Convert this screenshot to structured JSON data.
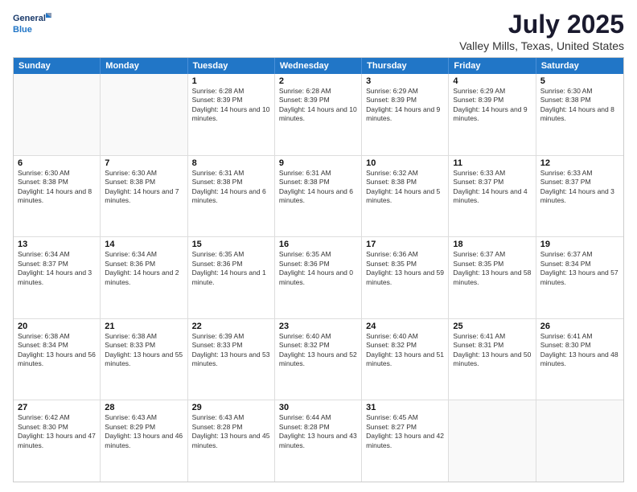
{
  "logo": {
    "line1": "General",
    "line2": "Blue"
  },
  "title": "July 2025",
  "subtitle": "Valley Mills, Texas, United States",
  "days_of_week": [
    "Sunday",
    "Monday",
    "Tuesday",
    "Wednesday",
    "Thursday",
    "Friday",
    "Saturday"
  ],
  "weeks": [
    [
      {
        "day": "",
        "sunrise": "",
        "sunset": "",
        "daylight": ""
      },
      {
        "day": "",
        "sunrise": "",
        "sunset": "",
        "daylight": ""
      },
      {
        "day": "1",
        "sunrise": "Sunrise: 6:28 AM",
        "sunset": "Sunset: 8:39 PM",
        "daylight": "Daylight: 14 hours and 10 minutes."
      },
      {
        "day": "2",
        "sunrise": "Sunrise: 6:28 AM",
        "sunset": "Sunset: 8:39 PM",
        "daylight": "Daylight: 14 hours and 10 minutes."
      },
      {
        "day": "3",
        "sunrise": "Sunrise: 6:29 AM",
        "sunset": "Sunset: 8:39 PM",
        "daylight": "Daylight: 14 hours and 9 minutes."
      },
      {
        "day": "4",
        "sunrise": "Sunrise: 6:29 AM",
        "sunset": "Sunset: 8:39 PM",
        "daylight": "Daylight: 14 hours and 9 minutes."
      },
      {
        "day": "5",
        "sunrise": "Sunrise: 6:30 AM",
        "sunset": "Sunset: 8:38 PM",
        "daylight": "Daylight: 14 hours and 8 minutes."
      }
    ],
    [
      {
        "day": "6",
        "sunrise": "Sunrise: 6:30 AM",
        "sunset": "Sunset: 8:38 PM",
        "daylight": "Daylight: 14 hours and 8 minutes."
      },
      {
        "day": "7",
        "sunrise": "Sunrise: 6:30 AM",
        "sunset": "Sunset: 8:38 PM",
        "daylight": "Daylight: 14 hours and 7 minutes."
      },
      {
        "day": "8",
        "sunrise": "Sunrise: 6:31 AM",
        "sunset": "Sunset: 8:38 PM",
        "daylight": "Daylight: 14 hours and 6 minutes."
      },
      {
        "day": "9",
        "sunrise": "Sunrise: 6:31 AM",
        "sunset": "Sunset: 8:38 PM",
        "daylight": "Daylight: 14 hours and 6 minutes."
      },
      {
        "day": "10",
        "sunrise": "Sunrise: 6:32 AM",
        "sunset": "Sunset: 8:38 PM",
        "daylight": "Daylight: 14 hours and 5 minutes."
      },
      {
        "day": "11",
        "sunrise": "Sunrise: 6:33 AM",
        "sunset": "Sunset: 8:37 PM",
        "daylight": "Daylight: 14 hours and 4 minutes."
      },
      {
        "day": "12",
        "sunrise": "Sunrise: 6:33 AM",
        "sunset": "Sunset: 8:37 PM",
        "daylight": "Daylight: 14 hours and 3 minutes."
      }
    ],
    [
      {
        "day": "13",
        "sunrise": "Sunrise: 6:34 AM",
        "sunset": "Sunset: 8:37 PM",
        "daylight": "Daylight: 14 hours and 3 minutes."
      },
      {
        "day": "14",
        "sunrise": "Sunrise: 6:34 AM",
        "sunset": "Sunset: 8:36 PM",
        "daylight": "Daylight: 14 hours and 2 minutes."
      },
      {
        "day": "15",
        "sunrise": "Sunrise: 6:35 AM",
        "sunset": "Sunset: 8:36 PM",
        "daylight": "Daylight: 14 hours and 1 minute."
      },
      {
        "day": "16",
        "sunrise": "Sunrise: 6:35 AM",
        "sunset": "Sunset: 8:36 PM",
        "daylight": "Daylight: 14 hours and 0 minutes."
      },
      {
        "day": "17",
        "sunrise": "Sunrise: 6:36 AM",
        "sunset": "Sunset: 8:35 PM",
        "daylight": "Daylight: 13 hours and 59 minutes."
      },
      {
        "day": "18",
        "sunrise": "Sunrise: 6:37 AM",
        "sunset": "Sunset: 8:35 PM",
        "daylight": "Daylight: 13 hours and 58 minutes."
      },
      {
        "day": "19",
        "sunrise": "Sunrise: 6:37 AM",
        "sunset": "Sunset: 8:34 PM",
        "daylight": "Daylight: 13 hours and 57 minutes."
      }
    ],
    [
      {
        "day": "20",
        "sunrise": "Sunrise: 6:38 AM",
        "sunset": "Sunset: 8:34 PM",
        "daylight": "Daylight: 13 hours and 56 minutes."
      },
      {
        "day": "21",
        "sunrise": "Sunrise: 6:38 AM",
        "sunset": "Sunset: 8:33 PM",
        "daylight": "Daylight: 13 hours and 55 minutes."
      },
      {
        "day": "22",
        "sunrise": "Sunrise: 6:39 AM",
        "sunset": "Sunset: 8:33 PM",
        "daylight": "Daylight: 13 hours and 53 minutes."
      },
      {
        "day": "23",
        "sunrise": "Sunrise: 6:40 AM",
        "sunset": "Sunset: 8:32 PM",
        "daylight": "Daylight: 13 hours and 52 minutes."
      },
      {
        "day": "24",
        "sunrise": "Sunrise: 6:40 AM",
        "sunset": "Sunset: 8:32 PM",
        "daylight": "Daylight: 13 hours and 51 minutes."
      },
      {
        "day": "25",
        "sunrise": "Sunrise: 6:41 AM",
        "sunset": "Sunset: 8:31 PM",
        "daylight": "Daylight: 13 hours and 50 minutes."
      },
      {
        "day": "26",
        "sunrise": "Sunrise: 6:41 AM",
        "sunset": "Sunset: 8:30 PM",
        "daylight": "Daylight: 13 hours and 48 minutes."
      }
    ],
    [
      {
        "day": "27",
        "sunrise": "Sunrise: 6:42 AM",
        "sunset": "Sunset: 8:30 PM",
        "daylight": "Daylight: 13 hours and 47 minutes."
      },
      {
        "day": "28",
        "sunrise": "Sunrise: 6:43 AM",
        "sunset": "Sunset: 8:29 PM",
        "daylight": "Daylight: 13 hours and 46 minutes."
      },
      {
        "day": "29",
        "sunrise": "Sunrise: 6:43 AM",
        "sunset": "Sunset: 8:28 PM",
        "daylight": "Daylight: 13 hours and 45 minutes."
      },
      {
        "day": "30",
        "sunrise": "Sunrise: 6:44 AM",
        "sunset": "Sunset: 8:28 PM",
        "daylight": "Daylight: 13 hours and 43 minutes."
      },
      {
        "day": "31",
        "sunrise": "Sunrise: 6:45 AM",
        "sunset": "Sunset: 8:27 PM",
        "daylight": "Daylight: 13 hours and 42 minutes."
      },
      {
        "day": "",
        "sunrise": "",
        "sunset": "",
        "daylight": ""
      },
      {
        "day": "",
        "sunrise": "",
        "sunset": "",
        "daylight": ""
      }
    ]
  ]
}
